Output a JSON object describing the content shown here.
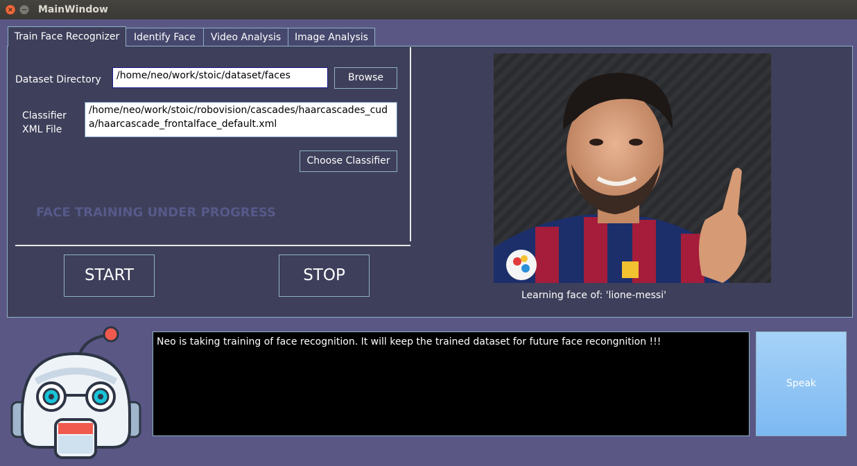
{
  "window": {
    "title": "MainWindow",
    "close_glyph": "×",
    "min_glyph": "−"
  },
  "tabs": [
    {
      "label": "Train Face Recognizer",
      "active": true
    },
    {
      "label": "Identify Face",
      "active": false
    },
    {
      "label": "Video Analysis",
      "active": false
    },
    {
      "label": "Image Analysis",
      "active": false
    }
  ],
  "train": {
    "dataset_label": "Dataset Directory",
    "dataset_value": "/home/neo/work/stoic/dataset/faces",
    "browse_label": "Browse",
    "classifier_label": "Classifier\nXML File",
    "classifier_value": "/home/neo/work/stoic/robovision/cascades/haarcascades_cuda/haarcascade_frontalface_default.xml",
    "choose_label": "Choose Classifier",
    "progress_text": "FACE TRAINING UNDER PROGRESS",
    "start_label": "START",
    "stop_label": "STOP",
    "caption": "Learning face of: 'lione-messi'"
  },
  "console": {
    "text": "Neo is taking training of face recognition. It will keep the trained dataset for future face recongnition !!!",
    "speak_label": "Speak"
  },
  "colors": {
    "background": "#5a5785",
    "pane": "#3e3f5a",
    "border": "#8fb3c6",
    "speak": "#8cc4f5",
    "progress_text": "#57598a"
  }
}
